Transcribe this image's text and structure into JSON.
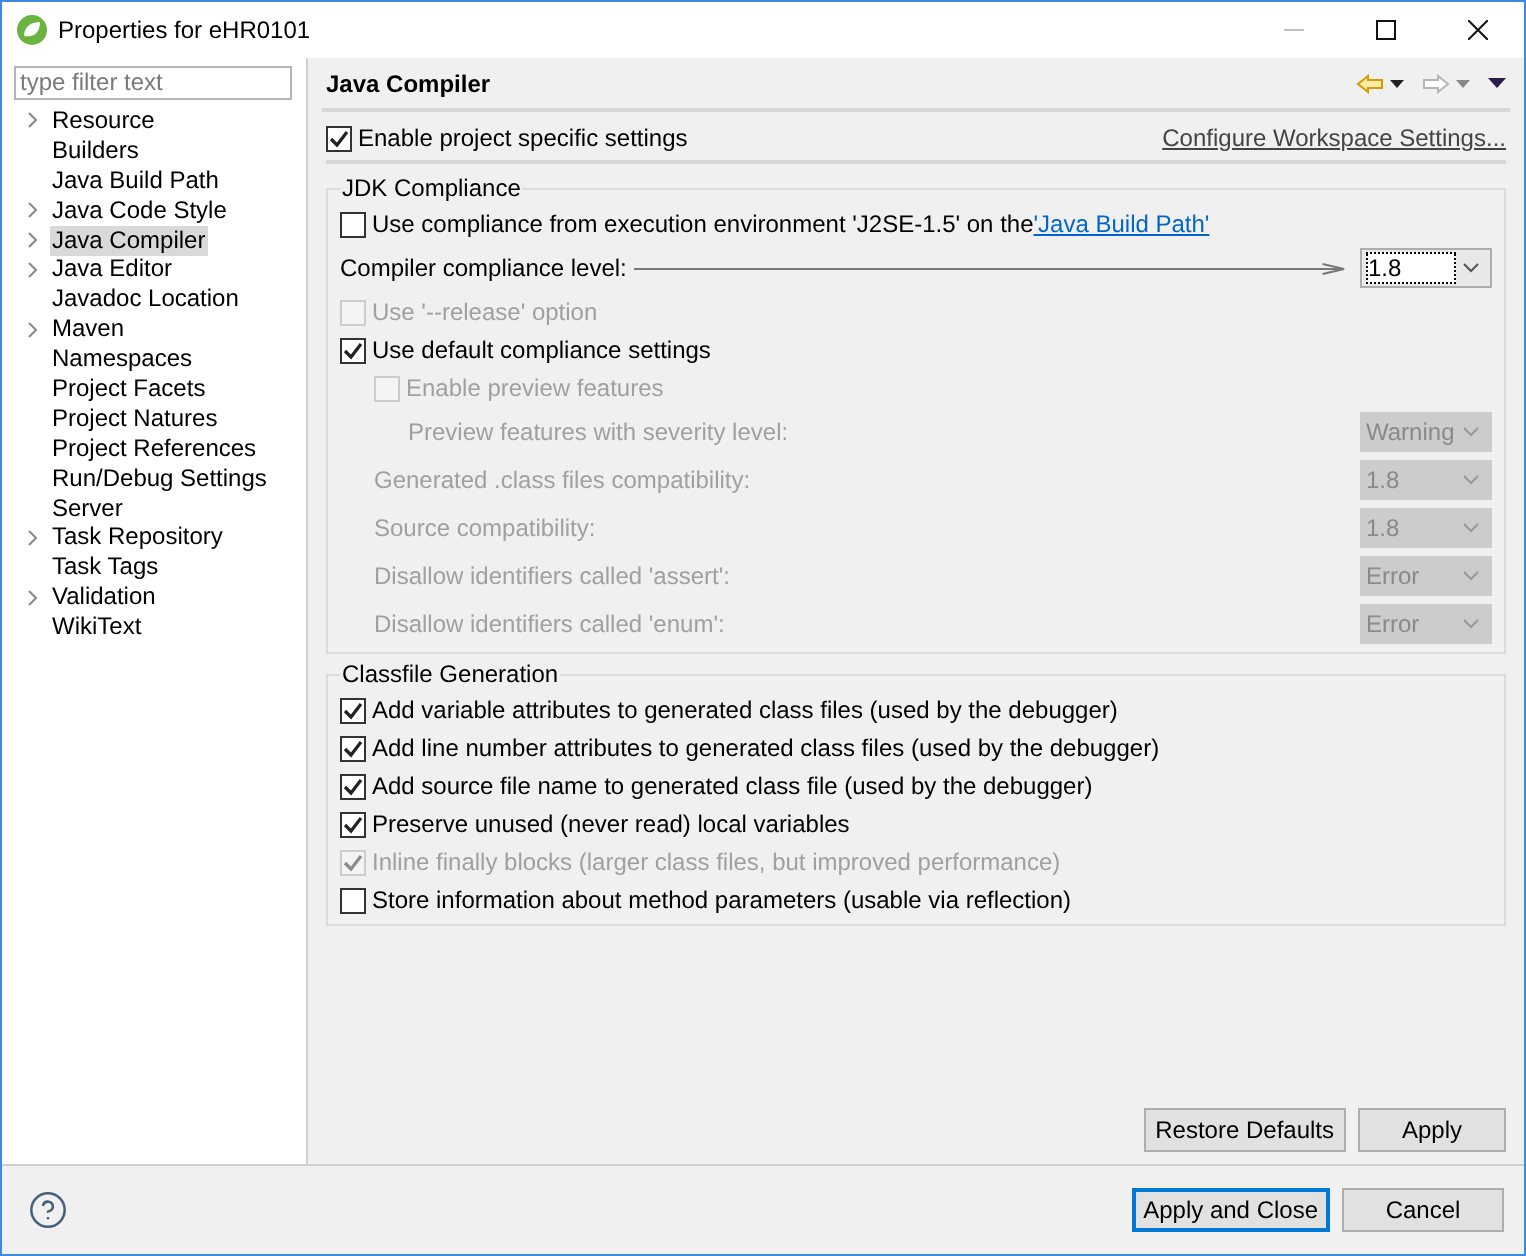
{
  "window": {
    "title": "Properties for eHR0101"
  },
  "filter": {
    "placeholder": "type filter text"
  },
  "tree": [
    {
      "label": "Resource",
      "expandable": true,
      "selected": false
    },
    {
      "label": "Builders",
      "expandable": false,
      "selected": false
    },
    {
      "label": "Java Build Path",
      "expandable": false,
      "selected": false
    },
    {
      "label": "Java Code Style",
      "expandable": true,
      "selected": false
    },
    {
      "label": "Java Compiler",
      "expandable": true,
      "selected": true
    },
    {
      "label": "Java Editor",
      "expandable": true,
      "selected": false
    },
    {
      "label": "Javadoc Location",
      "expandable": false,
      "selected": false
    },
    {
      "label": "Maven",
      "expandable": true,
      "selected": false
    },
    {
      "label": "Namespaces",
      "expandable": false,
      "selected": false
    },
    {
      "label": "Project Facets",
      "expandable": false,
      "selected": false
    },
    {
      "label": "Project Natures",
      "expandable": false,
      "selected": false
    },
    {
      "label": "Project References",
      "expandable": false,
      "selected": false
    },
    {
      "label": "Run/Debug Settings",
      "expandable": false,
      "selected": false
    },
    {
      "label": "Server",
      "expandable": false,
      "selected": false
    },
    {
      "label": "Task Repository",
      "expandable": true,
      "selected": false
    },
    {
      "label": "Task Tags",
      "expandable": false,
      "selected": false
    },
    {
      "label": "Validation",
      "expandable": true,
      "selected": false
    },
    {
      "label": "WikiText",
      "expandable": false,
      "selected": false
    }
  ],
  "page": {
    "title": "Java Compiler",
    "enable": {
      "label": "Enable project specific settings",
      "checked": true
    },
    "workspace_link": "Configure Workspace Settings..."
  },
  "jdk": {
    "title": "JDK Compliance",
    "items": [
      {
        "kind": "checkbox",
        "label": "Use compliance from execution environment 'J2SE-1.5' on the ",
        "link": "'Java Build Path'",
        "checked": false,
        "disabled": false
      },
      {
        "kind": "level",
        "label": "Compiler compliance level:",
        "value": "1.8",
        "disabled": false
      },
      {
        "kind": "checkbox",
        "label": "Use '--release' option",
        "checked": false,
        "disabled": true
      },
      {
        "kind": "checkbox",
        "label": "Use default compliance settings",
        "checked": true,
        "disabled": false,
        "children": [
          {
            "kind": "checkbox",
            "label": "Enable preview features",
            "checked": false,
            "disabled": true,
            "children": [
              {
                "kind": "combo",
                "label": "Preview features with severity level:",
                "value": "Warning",
                "disabled": true
              }
            ]
          },
          {
            "kind": "combo",
            "label": "Generated .class files compatibility:",
            "value": "1.8",
            "disabled": true
          },
          {
            "kind": "combo",
            "label": "Source compatibility:",
            "value": "1.8",
            "disabled": true
          },
          {
            "kind": "combo",
            "label": "Disallow identifiers called 'assert':",
            "value": "Error",
            "disabled": true
          },
          {
            "kind": "combo",
            "label": "Disallow identifiers called 'enum':",
            "value": "Error",
            "disabled": true
          }
        ]
      }
    ]
  },
  "classfile": {
    "title": "Classfile Generation",
    "items": [
      {
        "kind": "checkbox",
        "label": "Add variable attributes to generated class files (used by the debugger)",
        "checked": true,
        "disabled": false
      },
      {
        "kind": "checkbox",
        "label": "Add line number attributes to generated class files (used by the debugger)",
        "checked": true,
        "disabled": false
      },
      {
        "kind": "checkbox",
        "label": "Add source file name to generated class file (used by the debugger)",
        "checked": true,
        "disabled": false
      },
      {
        "kind": "checkbox",
        "label": "Preserve unused (never read) local variables",
        "checked": true,
        "disabled": false
      },
      {
        "kind": "checkbox",
        "label": "Inline finally blocks (larger class files, but improved performance)",
        "checked": true,
        "disabled": true
      },
      {
        "kind": "checkbox",
        "label": "Store information about method parameters (usable via reflection)",
        "checked": false,
        "disabled": false
      }
    ]
  },
  "page_buttons": [
    {
      "label": "Restore Defaults",
      "default": false
    },
    {
      "label": "Apply",
      "default": false
    }
  ],
  "dialog_buttons": [
    {
      "label": "Apply and Close",
      "default": true
    },
    {
      "label": "Cancel",
      "default": false
    }
  ]
}
